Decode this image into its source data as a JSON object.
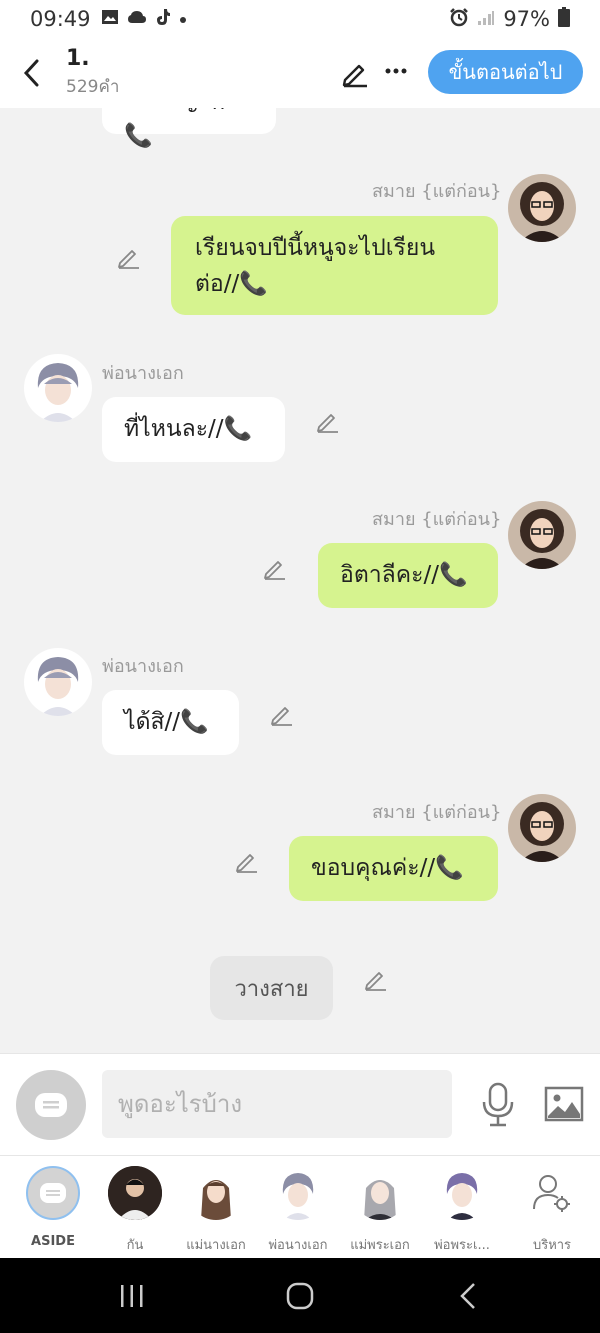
{
  "status_bar": {
    "time": "09:49",
    "battery": "97%",
    "icons": [
      "gallery-icon",
      "cloud-icon",
      "tiktok-icon",
      "dot-icon",
      "alarm-icon",
      "signal-icon",
      "battery-icon"
    ]
  },
  "header": {
    "title": "1.",
    "subtitle": "529คำ",
    "next_button": "ขั้นตอนต่อไป"
  },
  "messages": [
    {
      "side": "in",
      "text": "จ่ายบัญชี//📞"
    },
    {
      "side": "out",
      "name": "สมาย {แต่ก่อน}",
      "line1": "เรียนจบปีนี้หนูจะไปเรียน",
      "line2": "ต่อ//📞"
    },
    {
      "side": "in",
      "name": "พ่อนางเอก",
      "text": "ที่ไหนละ//📞"
    },
    {
      "side": "out",
      "name": "สมาย {แต่ก่อน}",
      "text": "อิตาลีคะ//📞"
    },
    {
      "side": "in",
      "name": "พ่อนางเอก",
      "text": "ได้สิ//📞"
    },
    {
      "side": "out",
      "name": "สมาย {แต่ก่อน}",
      "text": "ขอบคุณค่ะ//📞"
    }
  ],
  "system_message": "วางสาย",
  "input": {
    "placeholder": "พูดอะไรบ้าง"
  },
  "characters": [
    {
      "label": "ASIDE"
    },
    {
      "label": "กัน"
    },
    {
      "label": "แม่นางเอก"
    },
    {
      "label": "พ่อนางเอก"
    },
    {
      "label": "แม่พระเอก"
    },
    {
      "label": "พ่อพระเ..."
    },
    {
      "label": "บริหาร"
    }
  ],
  "colors": {
    "accent": "#4fa3f0",
    "outgoing_bubble": "#d6f38f",
    "incoming_bubble": "#ffffff",
    "chat_background": "#f2f2f2"
  }
}
